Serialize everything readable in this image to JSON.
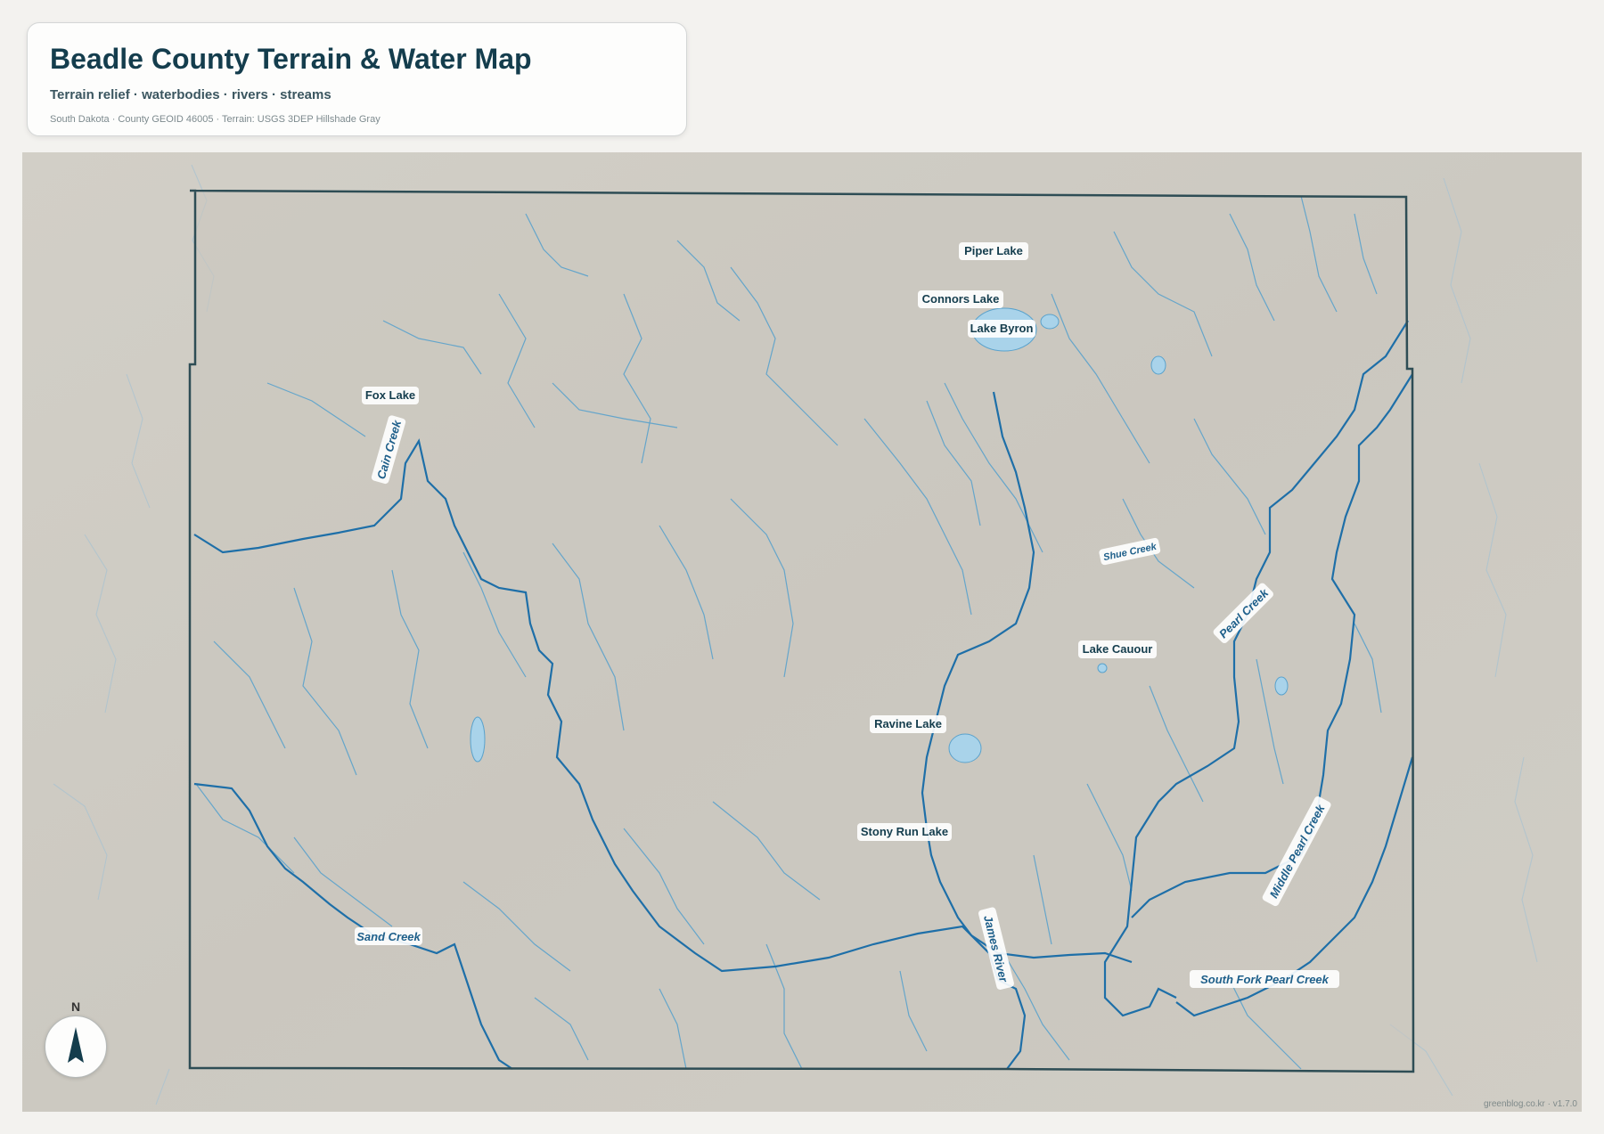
{
  "header": {
    "title": "Beadle County Terrain & Water Map",
    "subtitle": "Terrain relief · waterbodies · rivers · streams",
    "meta": "South Dakota · County GEOID 46005 · Terrain: USGS 3DEP Hillshade Gray"
  },
  "map": {
    "lakes": [
      "Piper Lake",
      "Connors Lake",
      "Lake Byron",
      "Fox Lake",
      "Lake Cauour",
      "Ravine Lake",
      "Stony Run Lake"
    ],
    "streams": [
      "Cain Creek",
      "Shue Creek",
      "Pearl Creek",
      "Middle Pearl Creek",
      "Sand Creek",
      "James River",
      "South Fork Pearl Creek"
    ]
  },
  "compass": {
    "label": "N"
  },
  "footer": {
    "attribution": "greenblog.co.kr · v1.7.0"
  },
  "colors": {
    "background": "#f3f2ef",
    "terrain": "#cdcac2",
    "county_boundary": "#2e4d55",
    "river": "#1e6fa8",
    "stream": "#5aa2cc",
    "lake_fill": "#a9d3ea",
    "title": "#143d4d"
  }
}
